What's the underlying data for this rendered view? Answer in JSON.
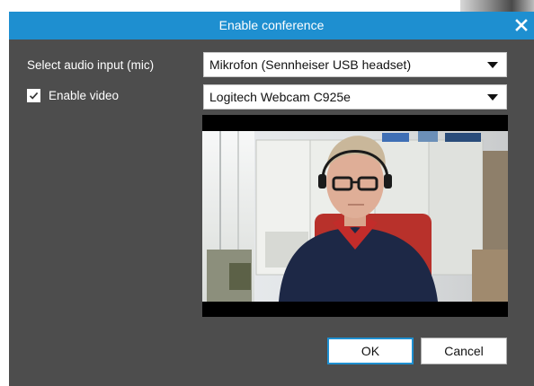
{
  "dialog": {
    "title": "Enable conference",
    "close_icon": "close-icon"
  },
  "audio": {
    "label": "Select audio input (mic)",
    "selected": "Mikrofon (Sennheiser USB headset)"
  },
  "video": {
    "checkbox_label": "Enable video",
    "checked": true,
    "selected": "Logitech Webcam C925e"
  },
  "buttons": {
    "ok": "OK",
    "cancel": "Cancel"
  },
  "colors": {
    "titlebar": "#1e8fd0",
    "dialog_bg": "#4d4d4d",
    "accent": "#1e8fd0"
  }
}
